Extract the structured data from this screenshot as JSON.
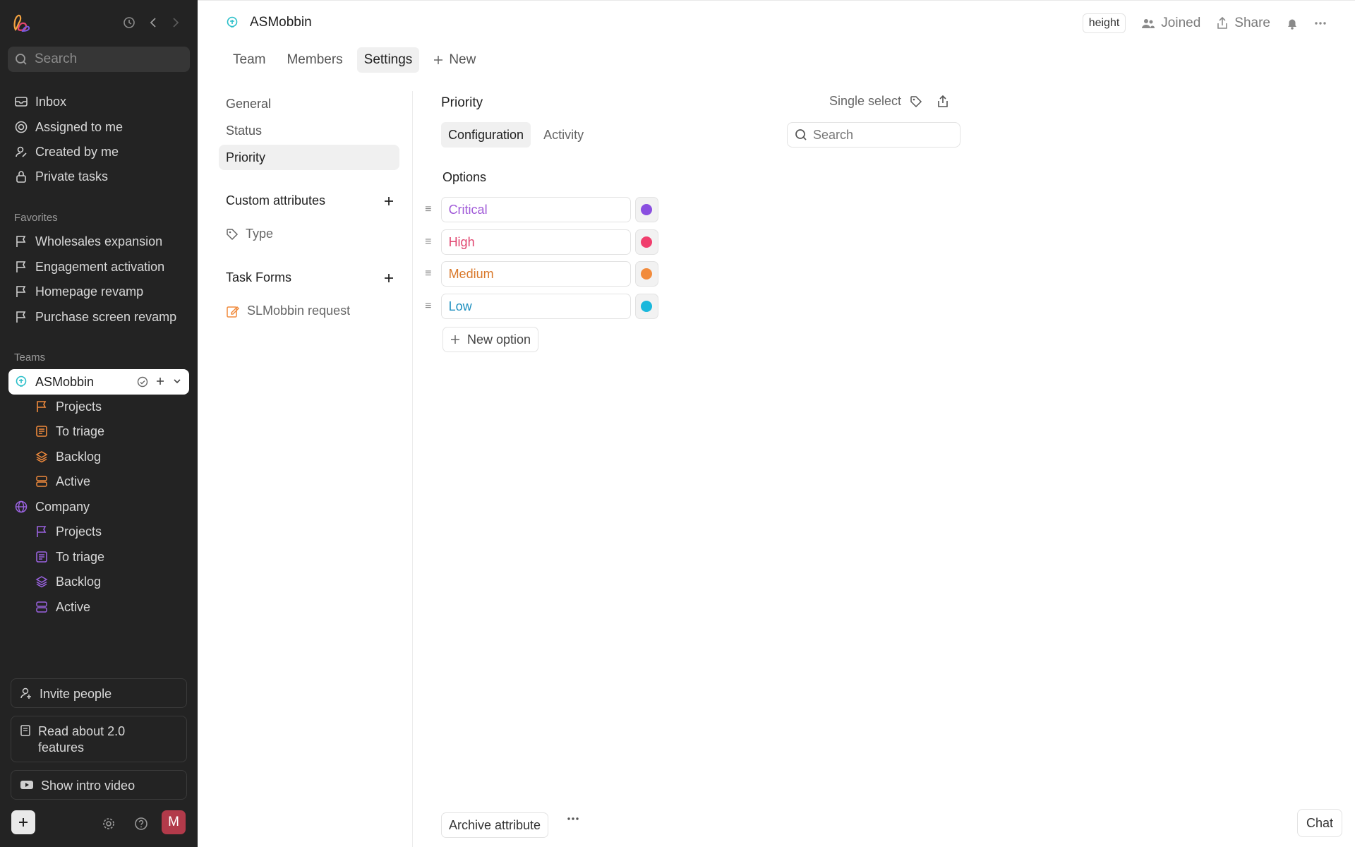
{
  "sidebar": {
    "search_placeholder": "Search",
    "nav": [
      {
        "label": "Inbox"
      },
      {
        "label": "Assigned to me"
      },
      {
        "label": "Created by me"
      },
      {
        "label": "Private tasks"
      }
    ],
    "favorites_heading": "Favorites",
    "favorites": [
      {
        "label": "Wholesales expansion"
      },
      {
        "label": "Engagement activation"
      },
      {
        "label": "Homepage revamp"
      },
      {
        "label": "Purchase screen revamp"
      }
    ],
    "teams_heading": "Teams",
    "team_asmobbin": {
      "label": "ASMobbin",
      "children": [
        {
          "label": "Projects"
        },
        {
          "label": "To triage"
        },
        {
          "label": "Backlog"
        },
        {
          "label": "Active"
        }
      ]
    },
    "team_company": {
      "label": "Company",
      "children": [
        {
          "label": "Projects"
        },
        {
          "label": "To triage"
        },
        {
          "label": "Backlog"
        },
        {
          "label": "Active"
        }
      ]
    },
    "invite_label": "Invite people",
    "read_label": "Read about 2.0 features",
    "video_label": "Show intro video",
    "avatar_initial": "M"
  },
  "header": {
    "team_name": "ASMobbin",
    "brand_badge": "height",
    "joined_label": "Joined",
    "share_label": "Share"
  },
  "tabs": [
    {
      "label": "Team"
    },
    {
      "label": "Members"
    },
    {
      "label": "Settings"
    },
    {
      "label": "New"
    }
  ],
  "settings_nav": {
    "items": [
      {
        "label": "General"
      },
      {
        "label": "Status"
      },
      {
        "label": "Priority"
      }
    ],
    "custom_attributes_heading": "Custom attributes",
    "custom_attributes": [
      {
        "label": "Type"
      }
    ],
    "task_forms_heading": "Task Forms",
    "task_forms": [
      {
        "label": "SLMobbin request"
      }
    ]
  },
  "panel": {
    "title": "Priority",
    "type_label": "Single select",
    "tabs": [
      {
        "label": "Configuration"
      },
      {
        "label": "Activity"
      }
    ],
    "search_placeholder": "Search",
    "options_heading": "Options",
    "options": [
      {
        "label": "Critical",
        "text_color": "#a05ad8",
        "dot_color": "#8a4fe0"
      },
      {
        "label": "High",
        "text_color": "#e0456f",
        "dot_color": "#f03e6d"
      },
      {
        "label": "Medium",
        "text_color": "#d9782a",
        "dot_color": "#f28b3c"
      },
      {
        "label": "Low",
        "text_color": "#1d8fbf",
        "dot_color": "#1ab8dc"
      }
    ],
    "new_option_label": "New option",
    "archive_label": "Archive attribute"
  },
  "chat_label": "Chat",
  "colors": {
    "sidebar_bg": "#232323",
    "accent_teal": "#2bbfc9",
    "accent_purple": "#9a63e0",
    "accent_orange": "#f08a3c"
  }
}
